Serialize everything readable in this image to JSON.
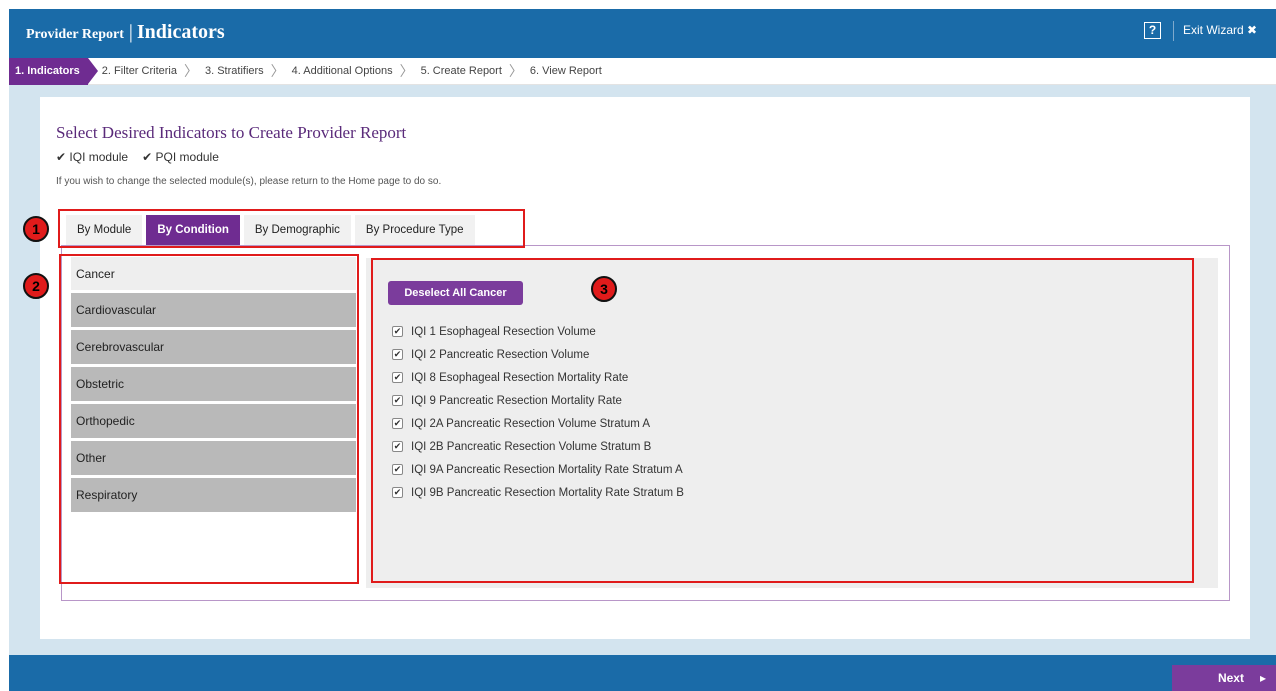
{
  "header": {
    "title_small": "Provider Report",
    "title_sep": "|",
    "title_big": "Indicators",
    "help": "?",
    "exit_label": "Exit Wizard",
    "exit_icon": "✖"
  },
  "steps": [
    {
      "label": "1. Indicators",
      "active": true
    },
    {
      "label": "2. Filter Criteria"
    },
    {
      "label": "3. Stratifiers"
    },
    {
      "label": "4. Additional Options"
    },
    {
      "label": "5. Create Report"
    },
    {
      "label": "6. View Report"
    }
  ],
  "main": {
    "title": "Select Desired Indicators to Create Provider Report",
    "modules": [
      "IQI module",
      "PQI module"
    ],
    "note": "If you wish to change the selected module(s), please return to the Home page to do so."
  },
  "tabs": [
    {
      "label": "By Module"
    },
    {
      "label": "By Condition",
      "active": true
    },
    {
      "label": "By Demographic"
    },
    {
      "label": "By Procedure Type"
    }
  ],
  "conditions": [
    {
      "label": "Cancer",
      "active": true
    },
    {
      "label": "Cardiovascular"
    },
    {
      "label": "Cerebrovascular"
    },
    {
      "label": "Obstetric"
    },
    {
      "label": "Orthopedic"
    },
    {
      "label": "Other"
    },
    {
      "label": "Respiratory"
    }
  ],
  "indicators": {
    "deselect_label": "Deselect All Cancer",
    "items": [
      "IQI 1 Esophageal Resection Volume",
      "IQI 2 Pancreatic Resection Volume",
      "IQI 8 Esophageal Resection Mortality Rate",
      "IQI 9 Pancreatic Resection Mortality Rate",
      "IQI 2A Pancreatic Resection Volume Stratum A",
      "IQI 2B Pancreatic Resection Volume Stratum B",
      "IQI 9A Pancreatic Resection Mortality Rate Stratum A",
      "IQI 9B Pancreatic Resection Mortality Rate Stratum B"
    ]
  },
  "annotations": [
    "1",
    "2",
    "3"
  ],
  "footer": {
    "next_label": "Next",
    "next_icon": "▸"
  }
}
